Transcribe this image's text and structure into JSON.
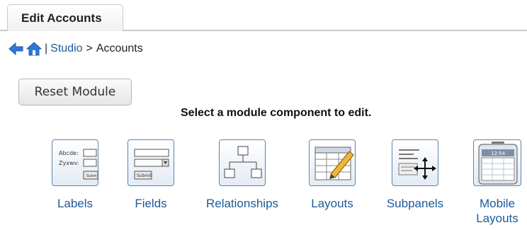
{
  "tab": {
    "label": "Edit Accounts"
  },
  "breadcrumb": {
    "separator": "|",
    "studio": "Studio",
    "arrow": ">",
    "current": "Accounts"
  },
  "toolbar": {
    "reset_label": "Reset Module"
  },
  "prompt": "Select a module component to edit.",
  "components": [
    {
      "label": "Labels",
      "icon": "labels-icon"
    },
    {
      "label": "Fields",
      "icon": "fields-icon"
    },
    {
      "label": "Relationships",
      "icon": "relationships-icon"
    },
    {
      "label": "Layouts",
      "icon": "layouts-icon"
    },
    {
      "label": "Subpanels",
      "icon": "subpanels-icon"
    },
    {
      "label": "Mobile Layouts",
      "icon": "mobile-layouts-icon"
    }
  ],
  "icon_text": {
    "labels_line1": "Abcde:",
    "labels_line2": "Zyxwv:",
    "labels_submit": "Subm",
    "fields_submit": "Submit",
    "mobile_time": "12:54"
  },
  "colors": {
    "link": "#1a5a9a",
    "icon_border": "#5b84b1",
    "back_arrow": "#2f78d4"
  }
}
